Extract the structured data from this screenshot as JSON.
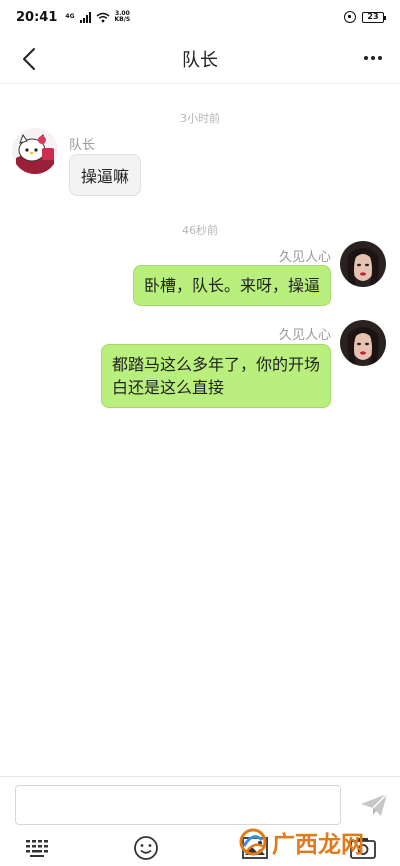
{
  "status_bar": {
    "time": "20:41",
    "network_label": "4G",
    "speed_value": "3.00",
    "speed_unit": "KB/S",
    "battery": "23"
  },
  "nav": {
    "title": "队长",
    "back_icon": "chevron-left-icon",
    "more_icon": "more-dots-icon"
  },
  "messages": [
    {
      "type": "time",
      "text": "3小时前"
    },
    {
      "type": "received",
      "sender": "队长",
      "text": "操逼嘛"
    },
    {
      "type": "time",
      "text": "46秒前"
    },
    {
      "type": "sent",
      "sender": "久见人心",
      "text": "卧槽，队长。来呀，操逼"
    },
    {
      "type": "sent",
      "sender": "久见人心",
      "lines": [
        "都踏马这么多年了，你的开场",
        "白还是这么直接"
      ]
    }
  ],
  "input": {
    "value": "",
    "placeholder": ""
  },
  "toolbar": {
    "icons": [
      "keyboard-icon",
      "emoji-icon",
      "image-icon",
      "camera-icon"
    ]
  },
  "watermark": {
    "text": "广西龙网"
  },
  "colors": {
    "sent_bubble": "#b9ef7d",
    "received_bubble": "#f3f3f3",
    "watermark": "#e07a1a"
  }
}
